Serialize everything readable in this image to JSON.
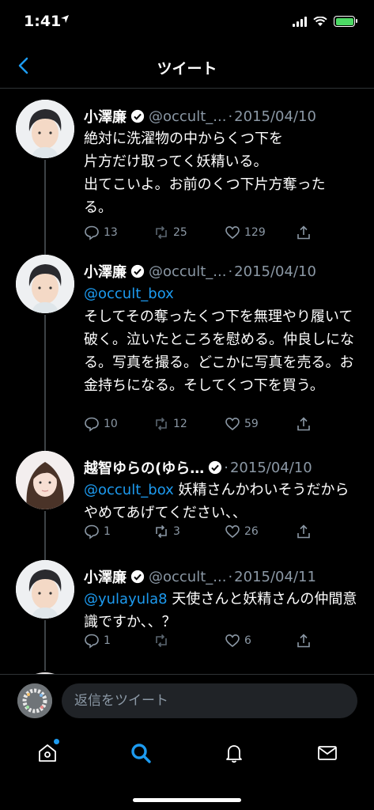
{
  "status_bar": {
    "time": "1:41",
    "location_icon": "location-arrow-icon",
    "battery_state": "charging",
    "battery_color": "#4cd964"
  },
  "header": {
    "title": "ツイート",
    "back_icon": "chevron-left-icon"
  },
  "colors": {
    "accent": "#1d9bf0",
    "secondary_text": "#8b98a5",
    "background": "#000000"
  },
  "tweets": [
    {
      "name": "小澤廉",
      "verified": true,
      "handle": "@occult_...",
      "separator": "·",
      "date": "2015/04/10",
      "mention": "",
      "text": "絶対に洗濯物の中からくつ下を\n片方だけ取ってく妖精いる。\n出てこいよ。お前のくつ下片方奪った\nる。",
      "replies": "13",
      "retweets": "25",
      "likes": "129"
    },
    {
      "name": "小澤廉",
      "verified": true,
      "handle": "@occult_...",
      "separator": "·",
      "date": "2015/04/10",
      "mention": "@occult_box",
      "text": "そしてその奪ったくつ下を無理やり履いて破く。泣いたところを慰める。仲良しになる。写真を撮る。どこかに写真を売る。お金持ちになる。そしてくつ下を買う。",
      "replies": "10",
      "retweets": "12",
      "likes": "59"
    },
    {
      "name": "越智ゆらの(ゆら…",
      "verified": true,
      "handle": "",
      "separator": "·",
      "date": "2015/04/10",
      "mention": "@occult_box",
      "text": " 妖精さんかわいそうだからやめてあげてください、、",
      "replies": "1",
      "retweets": "3",
      "likes": "26"
    },
    {
      "name": "小澤廉",
      "verified": true,
      "handle": "@occult_...",
      "separator": "·",
      "date": "2015/04/11",
      "mention": "@yulayula8",
      "text": " 天使さんと妖精さんの仲間意識ですか、、？",
      "replies": "1",
      "retweets": "",
      "likes": "6"
    }
  ],
  "reply_bar": {
    "placeholder": "返信をツイート"
  },
  "tab_bar": {
    "items": [
      "home-icon",
      "search-icon",
      "bell-icon",
      "mail-icon"
    ],
    "active": "search-icon"
  }
}
